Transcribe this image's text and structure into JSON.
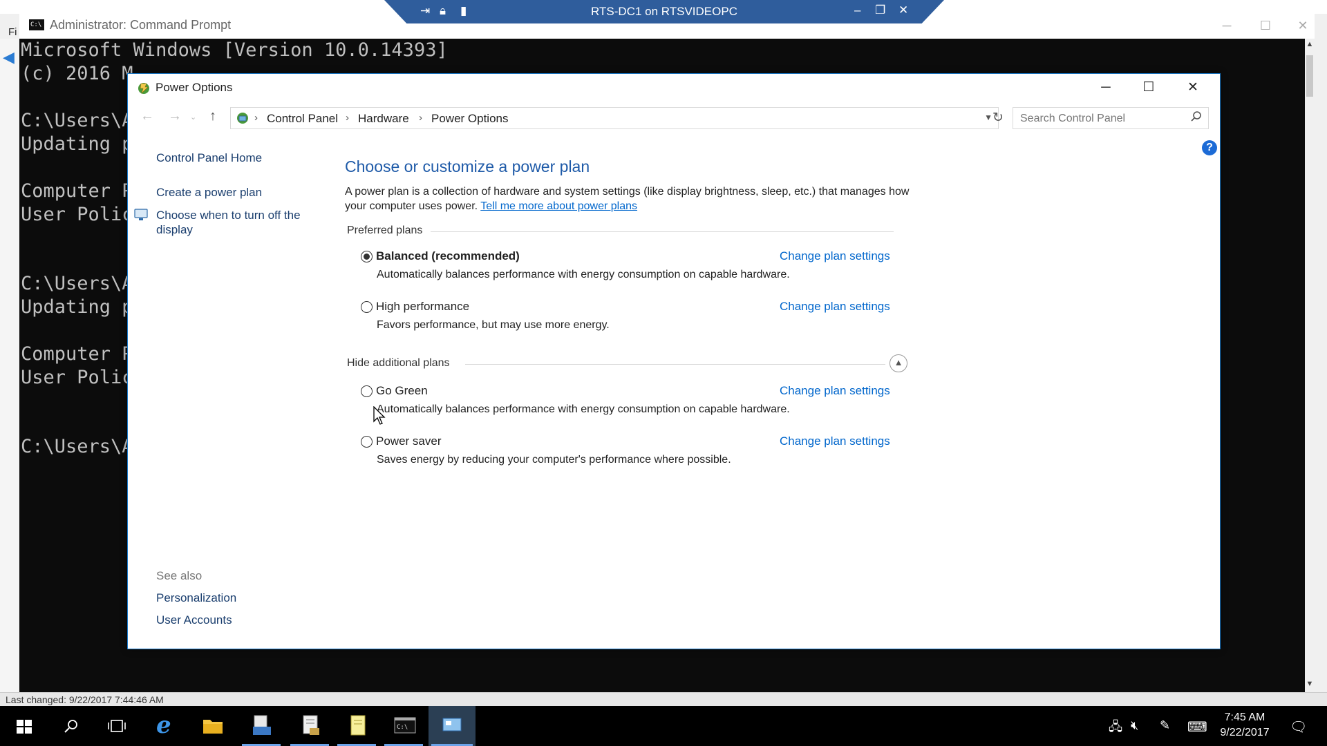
{
  "background": {
    "menu_fragment": "Fi",
    "status_text": "Last changed: 9/22/2017 7:44:46 AM"
  },
  "rdp_bar": {
    "title": "RTS-DC1 on RTSVIDEOPC"
  },
  "cmd": {
    "title": "Administrator: Command Prompt",
    "lines": [
      "Microsoft Windows [Version 10.0.14393]",
      "(c) 2016 M",
      "C:\\Users\\A",
      "Updating p",
      "Computer P",
      "User Polic",
      "C:\\Users\\A",
      "Updating p",
      "Computer P",
      "User Polic",
      "C:\\Users\\A"
    ]
  },
  "window": {
    "title": "Power Options"
  },
  "address": {
    "crumbs": [
      "Control Panel",
      "Hardware",
      "Power Options"
    ],
    "search_placeholder": "Search Control Panel"
  },
  "sidebar": {
    "home": "Control Panel Home",
    "create_plan": "Create a power plan",
    "turn_off_display": "Choose when to turn off the display",
    "see_also": "See also",
    "personalization": "Personalization",
    "user_accounts": "User Accounts"
  },
  "main": {
    "title": "Choose or customize a power plan",
    "description": "A power plan is a collection of hardware and system settings (like display brightness, sleep, etc.) that manages how your computer uses power.",
    "learn_more": "Tell me more about power plans",
    "preferred_header": "Preferred plans",
    "additional_header": "Hide additional plans",
    "change_link": "Change plan settings",
    "plans": [
      {
        "name": "Balanced (recommended)",
        "desc": "Automatically balances performance with energy consumption on capable hardware.",
        "selected": true
      },
      {
        "name": "High performance",
        "desc": "Favors performance, but may use more energy.",
        "selected": false
      },
      {
        "name": "Go Green",
        "desc": "Automatically balances performance with energy consumption on capable hardware.",
        "selected": false
      },
      {
        "name": "Power saver",
        "desc": "Saves energy by reducing your computer's performance where possible.",
        "selected": false
      }
    ]
  },
  "taskbar": {
    "time": "7:45 AM",
    "date": "9/22/2017"
  },
  "colors": {
    "accent": "#1e5aa8",
    "link": "#0066cc",
    "taskbar": "#000000"
  }
}
